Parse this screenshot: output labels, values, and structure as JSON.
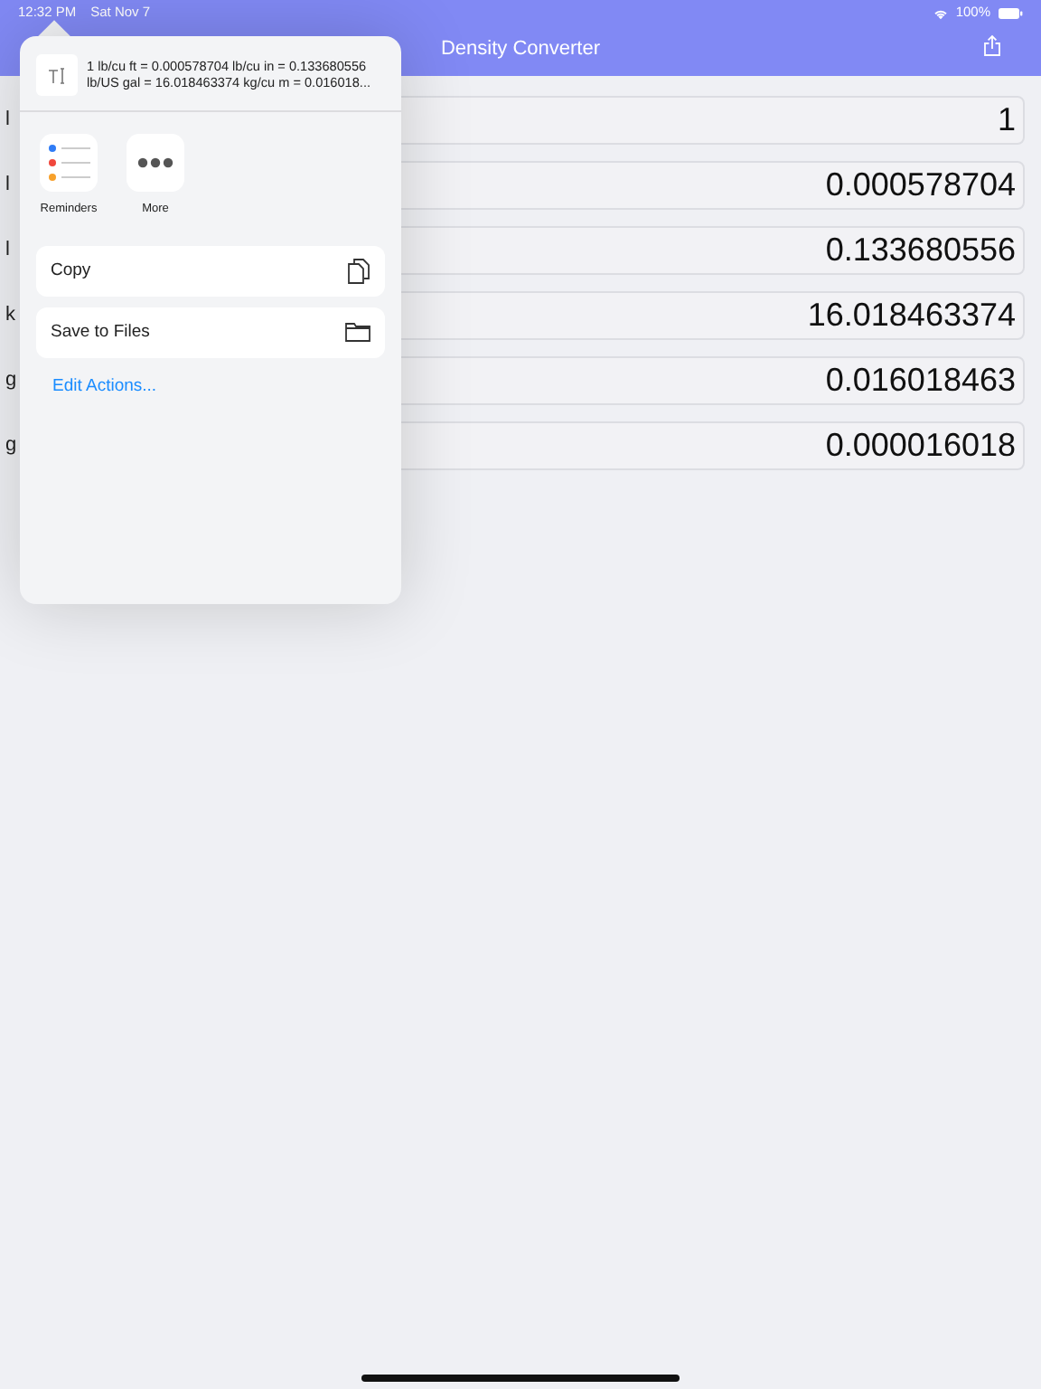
{
  "status_bar": {
    "time": "12:32 PM",
    "date": "Sat Nov 7",
    "battery_text": "100%"
  },
  "nav_bar": {
    "title": "Density Converter"
  },
  "rows": [
    {
      "label": "l",
      "value": "1"
    },
    {
      "label": "l",
      "value": "0.000578704"
    },
    {
      "label": "l",
      "value": "0.133680556"
    },
    {
      "label": "k",
      "value": "16.018463374"
    },
    {
      "label": "g",
      "value": "0.016018463"
    },
    {
      "label": "g",
      "value": "0.000016018"
    }
  ],
  "share_sheet": {
    "preview_text": "1 lb/cu ft = 0.000578704 lb/cu in = 0.133680556 lb/US gal = 16.018463374 kg/cu m = 0.016018...",
    "apps": [
      {
        "kind": "reminders",
        "label": "Reminders"
      },
      {
        "kind": "more",
        "label": "More"
      }
    ],
    "actions": [
      {
        "kind": "copy",
        "label": "Copy"
      },
      {
        "kind": "files",
        "label": "Save to Files"
      }
    ],
    "edit_link": "Edit Actions..."
  }
}
